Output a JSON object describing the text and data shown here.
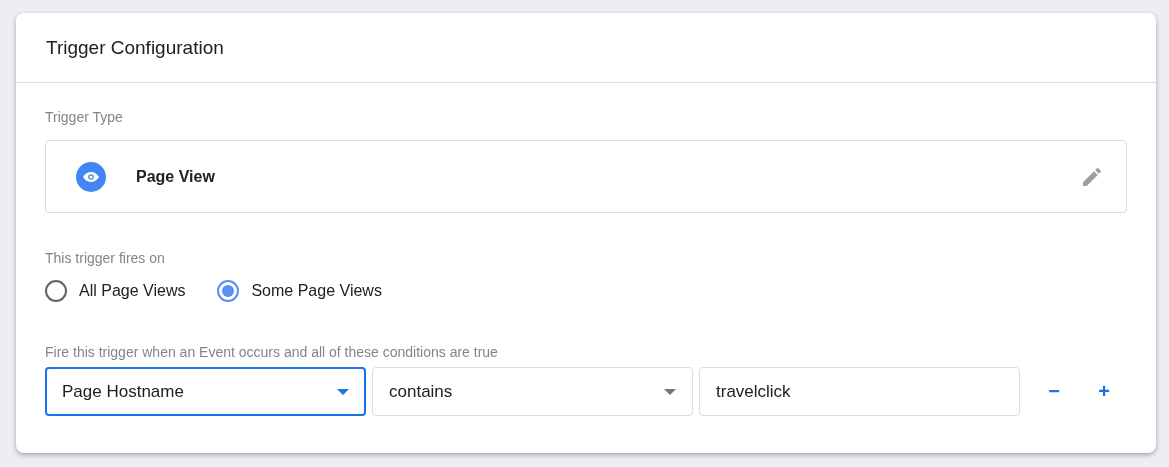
{
  "card": {
    "title": "Trigger Configuration"
  },
  "trigger_type": {
    "label": "Trigger Type",
    "name": "Page View"
  },
  "fires_on": {
    "label": "This trigger fires on",
    "options": [
      {
        "label": "All Page Views",
        "selected": false
      },
      {
        "label": "Some Page Views",
        "selected": true
      }
    ]
  },
  "conditions": {
    "label": "Fire this trigger when an Event occurs and all of these conditions are true",
    "fields": [
      {
        "kind": "select",
        "value": "Page Hostname",
        "focused": true
      },
      {
        "kind": "select",
        "value": "contains",
        "focused": false
      },
      {
        "kind": "text",
        "value": "travelclick",
        "focused": false
      }
    ],
    "buttons": [
      "−",
      "+"
    ]
  }
}
